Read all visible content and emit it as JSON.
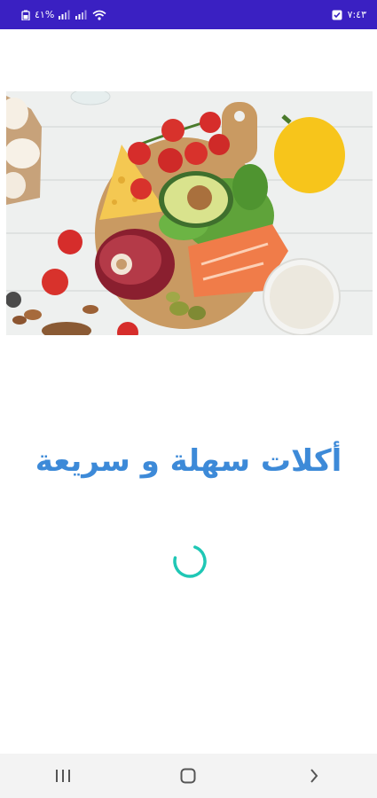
{
  "status_bar": {
    "time": "٧:٤٣",
    "battery": "٤١%",
    "icons": [
      "checklist-icon",
      "battery-icon",
      "signal-icon",
      "signal-icon",
      "wifi-icon"
    ],
    "background": "#3a20c2"
  },
  "hero": {
    "image": "food-platter-image",
    "description_icon": "photo-image"
  },
  "title": {
    "text": "أكلات سهلة و سريعة",
    "color": "#3d8ad8"
  },
  "loader": {
    "type": "circular-spinner",
    "color": "#1fc7b5"
  },
  "navigation": {
    "buttons": [
      "recent-apps-icon",
      "home-icon",
      "back-icon"
    ]
  }
}
